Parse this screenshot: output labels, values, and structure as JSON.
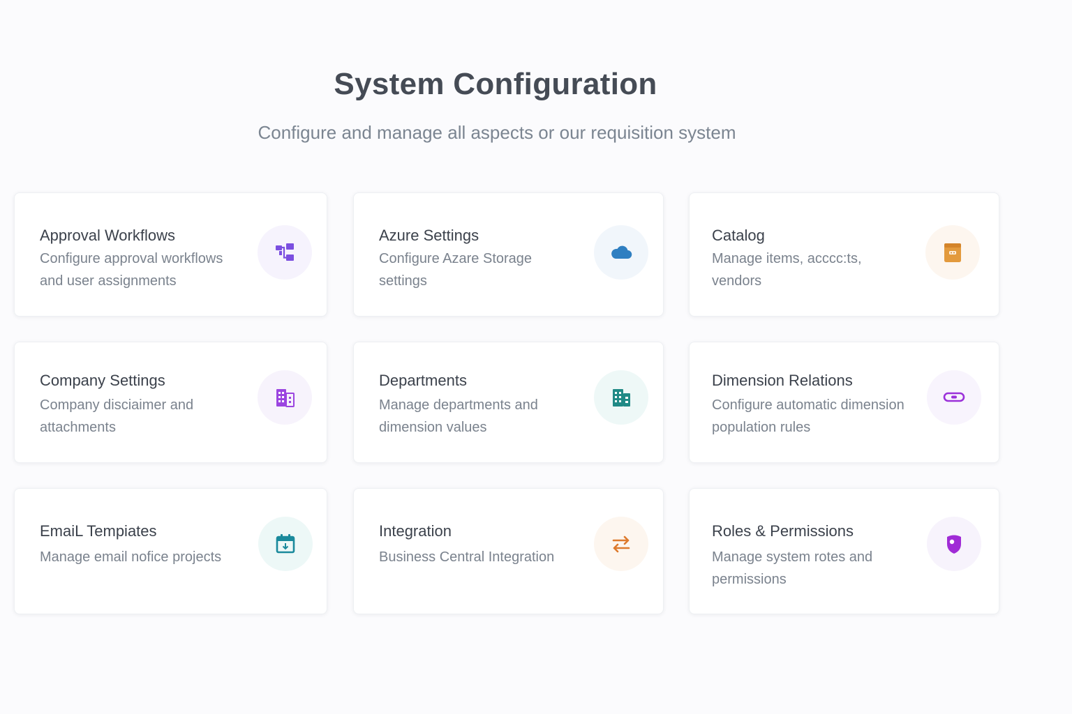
{
  "header": {
    "title": "System Configuration",
    "subtitle": "Configure and manage all aspects or our requisition system"
  },
  "cards": [
    {
      "title": "Approval Workflows",
      "description": "Configure approval workflows and user assignments",
      "icon": "workflow-icon",
      "icon_color": "#7b4fe0",
      "icon_bg": "#f6f3fd"
    },
    {
      "title": "Azure Settings",
      "description": "Configure Azare Storage settings",
      "icon": "cloud-icon",
      "icon_color": "#2f7fc1",
      "icon_bg": "#f1f6fb"
    },
    {
      "title": "Catalog",
      "description": "Manage items, acccc:ts, vendors",
      "icon": "catalog-box-icon",
      "icon_color": "#e39a3d",
      "icon_bg": "#fdf6ef"
    },
    {
      "title": "Company Settings",
      "description": "Company disciaimer  and attachments",
      "icon": "company-building-icon",
      "icon_color": "#9b45e0",
      "icon_bg": "#f7f3fc"
    },
    {
      "title": "Departments",
      "description": "Manage departments and dimension values",
      "icon": "departments-building-icon",
      "icon_color": "#208a86",
      "icon_bg": "#eef8f7"
    },
    {
      "title": "Dimension Relations",
      "description": "Configure automatic dimension population rules",
      "icon": "link-icon",
      "icon_color": "#9b30d9",
      "icon_bg": "#f8f4fd"
    },
    {
      "title": "EmaiL Tempiates",
      "description": "Manage email nofice  projects",
      "icon": "calendar-icon",
      "icon_color": "#1a8a9c",
      "icon_bg": "#edf8f7"
    },
    {
      "title": "Integration",
      "description": "Business Central Integration",
      "icon": "swap-arrows-icon",
      "icon_color": "#dd7a2d",
      "icon_bg": "#fdf6ef"
    },
    {
      "title": "Roles & Permissions",
      "description": "Manage system rotes and permissions",
      "icon": "shield-icon",
      "icon_color": "#a02bd6",
      "icon_bg": "#f7f3fc"
    }
  ]
}
